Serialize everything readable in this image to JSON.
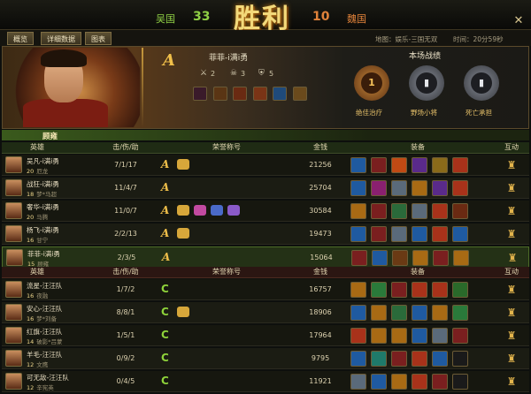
{
  "header": {
    "left_team": "吴国",
    "left_score": "33",
    "title": "胜利",
    "right_score": "10",
    "right_team": "魏国"
  },
  "tabs": [
    "概览",
    "详细数据",
    "图表"
  ],
  "map_info": "地图：娱乐-三国无双",
  "time_info": "时间：20分59秒",
  "banner": {
    "player_name": "菲菲-i满i勇",
    "rank": "A",
    "kills": "2",
    "deaths": "3",
    "assists": "5",
    "performance_title": "本场战绩",
    "badges": [
      "绝佳治疗",
      "野场小将",
      "死亡承担"
    ]
  },
  "colors": {
    "win": "#8fcf45",
    "lose": "#e0823a",
    "gold": "#f1c04a"
  },
  "team_a": {
    "label": "顾雍",
    "headers": [
      "英雄",
      "击/伤/助",
      "荣誉称号",
      "金钱",
      "装备",
      "互动"
    ],
    "rows": [
      {
        "name": "吴凡-i满i勇",
        "level": "20",
        "hero": "厄龙",
        "kda": "7/1/17",
        "rank": "A",
        "honors": 1,
        "gold": "21256"
      },
      {
        "name": "战狂-i满i勇",
        "level": "18",
        "hero": "梦*马超",
        "kda": "11/4/7",
        "rank": "A",
        "honors": 0,
        "gold": "25704"
      },
      {
        "name": "奢华-i满i勇",
        "level": "20",
        "hero": "马腾",
        "kda": "11/0/7",
        "rank": "A",
        "honors": 4,
        "gold": "30584"
      },
      {
        "name": "杨飞-i满i勇",
        "level": "16",
        "hero": "甘宁",
        "kda": "2/2/13",
        "rank": "A",
        "honors": 1,
        "gold": "19473"
      },
      {
        "name": "菲菲-i满i勇",
        "level": "15",
        "hero": "顾雍",
        "kda": "2/3/5",
        "rank": "A",
        "honors": 0,
        "gold": "15064",
        "self": true
      }
    ]
  },
  "team_b": {
    "headers": [
      "英雄",
      "击/伤/助",
      "荣誉称号",
      "金钱",
      "装备",
      "互动"
    ],
    "rows": [
      {
        "name": "流星-汪汪队",
        "level": "16",
        "hero": "夜融",
        "kda": "1/7/2",
        "rank": "C",
        "honors": 0,
        "gold": "16757"
      },
      {
        "name": "安心-汪汪队",
        "level": "16",
        "hero": "梦*刘备",
        "kda": "8/8/1",
        "rank": "C",
        "honors": 1,
        "gold": "18906"
      },
      {
        "name": "红旗-汪汪队",
        "level": "14",
        "hero": "破影*吕蒙",
        "kda": "1/5/1",
        "rank": "C",
        "honors": 0,
        "gold": "17964"
      },
      {
        "name": "羊毛-汪汪队",
        "level": "12",
        "hero": "文鹰",
        "kda": "0/9/2",
        "rank": "C",
        "honors": 0,
        "gold": "9795"
      },
      {
        "name": "可无敌-汪汪队",
        "level": "12",
        "hero": "辛宪英",
        "kda": "0/4/5",
        "rank": "C",
        "honors": 0,
        "gold": "11921"
      }
    ]
  },
  "icons": {
    "close": "close-icon",
    "interact": "trophy-icon",
    "kill": "swords-icon",
    "death": "skull-icon",
    "assist": "shield-icon"
  }
}
